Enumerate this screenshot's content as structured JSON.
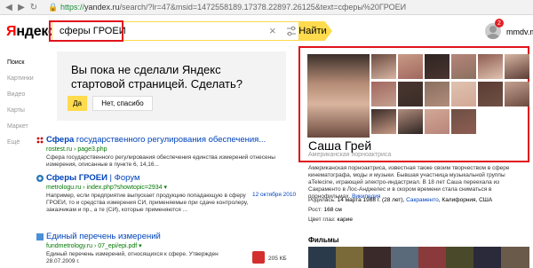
{
  "browser": {
    "url_scheme": "https://",
    "url_host": "yandex.ru",
    "url_rest": "/search/?lr=47&msid=1472558189.17378.22897.26125&text=сферы%20ГРОЕИ"
  },
  "header": {
    "logo_letter": "Я",
    "logo_rest": "ндекс",
    "query": "сферы ГРОЕИ",
    "find_label": "Найти",
    "badge_count": "2",
    "user_name": "mmdv.mm"
  },
  "left_nav": [
    {
      "label": "Поиск",
      "active": true
    },
    {
      "label": "Картинки"
    },
    {
      "label": "Видео"
    },
    {
      "label": "Карты"
    },
    {
      "label": "Маркет"
    },
    {
      "label": "Ещё"
    }
  ],
  "promo": {
    "text": "Вы пока не сделали Яндекс стартовой страницей. Сделать?",
    "yes": "Да",
    "no": "Нет, спасибо"
  },
  "results": [
    {
      "title_bold": "Сфера",
      "title_rest": " государственного регулирования обеспечения...",
      "url": "rostest.ru › page3.php",
      "snippet": "Сфера государственного регулирования обеспечения единства измерений отнесены измерения, описанные в пункте 6, 14,16..."
    },
    {
      "title_bold": "Сферы ГРОЕИ",
      "title_rest": " | Форум",
      "url": "metrologu.ru › index.php?showtopic=2934 ▾",
      "snippet": "Например, если предприятие выпускает продукцию попадающую в сферу ГРОЕИ, то и средства измерения СИ, применяемые при сдаче контролеру, заказчикам и пр., а те (СИ), которые применяются ...",
      "date": "12 октября 2010"
    },
    {
      "title_bold": "",
      "title_rest": "Единый перечень измерений",
      "url": "fundmetrology.ru › 07_epi/epi.pdf ▾",
      "snippet": "Единый перечень измерений, относящихся к сфере. Утвержден 28.07.2009 г.",
      "size": "205 КБ"
    }
  ],
  "knowledge_panel": {
    "name": "Саша Грей",
    "subtitle": "Американская порноактриса",
    "description": "Американская порноактриса, известная также своим творчеством в сфере кинематографа, моды и музыки. Бывшая участница музыкальной группы aTelecine, играющей электро-индастриал. В 18 лет Саша переехала из Сакраменто в Лос-Анджелес и в скором времени стала сниматься в порнофильмах.",
    "wiki_link": "Википедия",
    "born_label": "Родилась:",
    "born_value": "14 марта 1988 г. (28 лет),",
    "born_place_link": "Сакраменто",
    "born_place_rest": ", Калифорния, США",
    "height_label": "Рост:",
    "height_value": "168 см",
    "eyes_label": "Цвет глаз:",
    "eyes_value": "карие",
    "films_heading": "Фильмы"
  }
}
